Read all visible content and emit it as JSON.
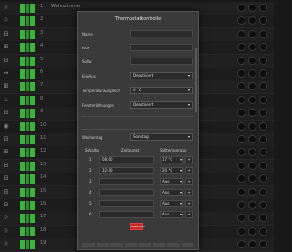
{
  "background": {
    "rows": [
      {
        "icon": "☼",
        "num": "1",
        "name": "Wohnzimmer",
        "status": ""
      },
      {
        "icon": "☼",
        "num": "2",
        "name": "",
        "status": ""
      },
      {
        "icon": "⊟",
        "num": "3",
        "name": "",
        "status": ""
      },
      {
        "icon": "⊞",
        "num": "4",
        "name": "",
        "status": ""
      },
      {
        "icon": "⊟",
        "num": "5",
        "name": "",
        "status": ""
      },
      {
        "icon": "↔",
        "num": "6",
        "name": "",
        "status": ""
      },
      {
        "icon": "⊞",
        "num": "7",
        "name": "",
        "status": ""
      },
      {
        "icon": "♨",
        "num": "8",
        "name": "",
        "status": ""
      },
      {
        "icon": "⊟",
        "num": "9",
        "name": "",
        "status": ""
      },
      {
        "icon": "◉",
        "num": "10",
        "name": "",
        "status": ""
      },
      {
        "icon": "⊟",
        "num": "11",
        "name": "",
        "status": ""
      },
      {
        "icon": "⊞",
        "num": "12",
        "name": "",
        "status": ""
      },
      {
        "icon": "⊟",
        "num": "13",
        "name": "",
        "status": ""
      },
      {
        "icon": "⊟",
        "num": "14",
        "name": "",
        "status": ""
      },
      {
        "icon": "⊟",
        "num": "15",
        "name": "",
        "status": ""
      },
      {
        "icon": "⊟",
        "num": "16",
        "name": "",
        "status": ""
      },
      {
        "icon": "☼",
        "num": "17",
        "name": "",
        "status": ""
      },
      {
        "icon": "☼",
        "num": "18",
        "name": "",
        "status": ""
      },
      {
        "icon": "☼",
        "num": "19",
        "name": "",
        "status": ""
      }
    ]
  },
  "modal": {
    "title": "Thermostatkontrolle",
    "fields": {
      "name_label": "Name",
      "name_value": "",
      "field2_label": "Istw",
      "field2_value": "",
      "field3_label": "Sollw",
      "field3_value": "",
      "ein_label": "Ein/Aus",
      "ein_value": "Deaktiviert",
      "comp_label": "Temperaturausgleich",
      "comp_value": "0 °C",
      "window_label": "Fensteröffnungen",
      "window_value": "Deaktiviert"
    },
    "schedule": {
      "day_label": "Wochentag",
      "day_value": "Sonntag",
      "col_slot": "Schaltp.",
      "col_time": "Zeitpunkt",
      "col_temp": "Solltemperatur",
      "slots": [
        {
          "num": "1",
          "time": "08:00",
          "temp": "17 °C",
          "btn": "+"
        },
        {
          "num": "2",
          "time": "22:00",
          "temp": "20 °C",
          "btn": "+"
        },
        {
          "num": "3",
          "time": "",
          "temp": "Aus",
          "btn": "+"
        },
        {
          "num": "4",
          "time": "",
          "temp": "Aus",
          "btn": "+"
        },
        {
          "num": "5",
          "time": "",
          "temp": "Aus",
          "btn": "+"
        },
        {
          "num": "6",
          "time": "",
          "temp": "Aus",
          "btn": "+"
        }
      ]
    },
    "save_label": "Speichern",
    "footer_label": ""
  }
}
